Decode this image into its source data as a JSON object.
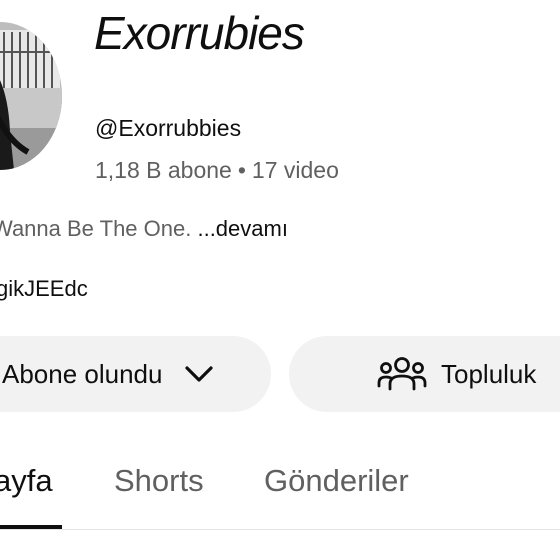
{
  "channel": {
    "name": "Exorrubies",
    "handle": "@Exorrubbies",
    "subscribers": "1,18 B abone",
    "separator": "•",
    "videos": "17 video"
  },
  "description": {
    "text": "Wanna Be The One. ",
    "more_label": "...devamı"
  },
  "link": {
    "text": "gikJEEdc"
  },
  "actions": {
    "subscribed_label": "Abone olundu",
    "community_label": "Topluluk"
  },
  "tabs": [
    {
      "label": "ayfa",
      "active": true
    },
    {
      "label": "Shorts",
      "active": false
    },
    {
      "label": "Gönderiler",
      "active": false
    }
  ],
  "icons": {
    "subscribed_dropdown": "chevron-down-icon",
    "community": "people-icon"
  },
  "colors": {
    "text_primary": "#0f0f0f",
    "text_secondary": "#606060",
    "button_bg": "#f2f2f2",
    "background": "#ffffff"
  }
}
